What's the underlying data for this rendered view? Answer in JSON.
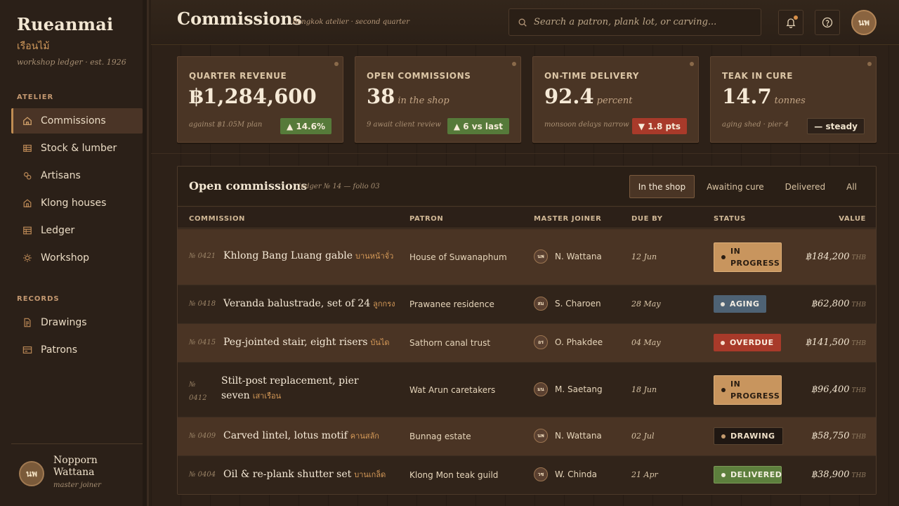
{
  "brand": {
    "name": "Rueanmai",
    "thai": "เรือนไม้",
    "tagline": "workshop ledger · est. 1926"
  },
  "sidebar": {
    "atelier_label": "ATELIER",
    "records_label": "RECORDS",
    "items": [
      {
        "label": "Commissions",
        "icon": "home-icon"
      },
      {
        "label": "Stock & lumber",
        "icon": "stack-icon"
      },
      {
        "label": "Artisans",
        "icon": "people-icon"
      },
      {
        "label": "Klong houses",
        "icon": "house-icon"
      },
      {
        "label": "Ledger",
        "icon": "grid-icon"
      },
      {
        "label": "Workshop",
        "icon": "sun-icon"
      },
      {
        "label": "Drawings",
        "icon": "document-icon"
      },
      {
        "label": "Patrons",
        "icon": "card-icon"
      }
    ],
    "user": {
      "initials": "นพ",
      "name": "Nopporn Wattana",
      "role": "master joiner"
    }
  },
  "header": {
    "title": "Commissions",
    "subtitle": "Bangkok atelier · second quarter",
    "search_placeholder": "Search a patron, plank lot, or carving...",
    "avatar_initials": "นพ"
  },
  "kpis": [
    {
      "label": "QUARTER REVENUE",
      "value": "฿1,284,600",
      "unit": "",
      "note": "against ฿1.05M plan",
      "badge": "▲ 14.6%",
      "badge_color": "#567a3a"
    },
    {
      "label": "OPEN COMMISSIONS",
      "value": "38",
      "unit": "in the shop",
      "note": "9 await client review",
      "badge": "▲ 6 vs last",
      "badge_color": "#567a3a"
    },
    {
      "label": "ON-TIME DELIVERY",
      "value": "92.4",
      "unit": "percent",
      "note": "monsoon delays narrow",
      "badge": "▼ 1.8 pts",
      "badge_color": "#a83a2a"
    },
    {
      "label": "TEAK IN CURE",
      "value": "14.7",
      "unit": "tonnes",
      "note": "aging shed · pier 4",
      "badge": "— steady",
      "badge_color": "#2d2119"
    }
  ],
  "ledger": {
    "title": "Open commissions",
    "subtitle": "ledger № 14 — folio 03",
    "filters": [
      "In the shop",
      "Awaiting cure",
      "Delivered",
      "All"
    ],
    "active_filter": "In the shop",
    "columns": [
      "COMMISSION",
      "PATRON",
      "MASTER JOINER",
      "DUE BY",
      "STATUS",
      "VALUE"
    ],
    "currency": "THB",
    "rows": [
      {
        "no": "№ 0421",
        "title": "Khlong Bang Luang gable",
        "thai": "บานหน้าจั่ว",
        "patron": "House of Suwanaphum",
        "joiner_initials": "นพ",
        "joiner": "N. Wattana",
        "due": "12 Jun",
        "status": "IN PROGRESS",
        "value": "฿184,200"
      },
      {
        "no": "№ 0418",
        "title": "Veranda balustrade, set of 24",
        "thai": "ลูกกรง",
        "patron": "Prawanee residence",
        "joiner_initials": "สม",
        "joiner": "S. Charoen",
        "due": "28 May",
        "status": "AGING",
        "value": "฿62,800"
      },
      {
        "no": "№ 0415",
        "title": "Peg-jointed stair, eight risers",
        "thai": "บันได",
        "patron": "Sathorn canal trust",
        "joiner_initials": "อร",
        "joiner": "O. Phakdee",
        "due": "04 May",
        "status": "OVERDUE",
        "value": "฿141,500"
      },
      {
        "no": "№ 0412",
        "title": "Stilt-post replacement, pier seven",
        "thai": "เสาเรือน",
        "patron": "Wat Arun caretakers",
        "joiner_initials": "มน",
        "joiner": "M. Saetang",
        "due": "18 Jun",
        "status": "IN PROGRESS",
        "value": "฿96,400"
      },
      {
        "no": "№ 0409",
        "title": "Carved lintel, lotus motif",
        "thai": "คานสลัก",
        "patron": "Bunnag estate",
        "joiner_initials": "นพ",
        "joiner": "N. Wattana",
        "due": "02 Jul",
        "status": "DRAWING",
        "value": "฿58,750"
      },
      {
        "no": "№ 0404",
        "title": "Oil & re-plank shutter set",
        "thai": "บานเกล็ด",
        "patron": "Klong Mon teak guild",
        "joiner_initials": "วช",
        "joiner": "W. Chinda",
        "due": "21 Apr",
        "status": "DELIVERED",
        "value": "฿38,900"
      }
    ]
  }
}
